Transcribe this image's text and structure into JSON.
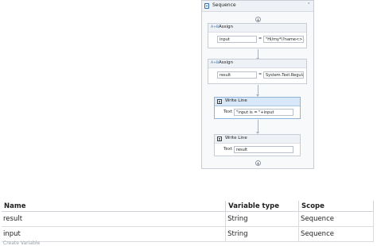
{
  "designer": {
    "sequence_title": "Sequence",
    "activities": [
      {
        "title": "Assign",
        "to": "input",
        "value": "\"Hi/my*\\?name<>?\""
      },
      {
        "title": "Assign",
        "to": "result",
        "value": "System.Text.Regula"
      },
      {
        "title": "Write Line",
        "text_label": "Text",
        "text_value": "\"input is = \"+input"
      },
      {
        "title": "Write Line",
        "text_label": "Text",
        "text_value": "result"
      }
    ]
  },
  "variables": {
    "columns": [
      "Name",
      "Variable type",
      "Scope"
    ],
    "rows": [
      {
        "name": "result",
        "type": "String",
        "scope": "Sequence"
      },
      {
        "name": "input",
        "type": "String",
        "scope": "Sequence"
      }
    ],
    "create_variable": "Create Variable"
  }
}
